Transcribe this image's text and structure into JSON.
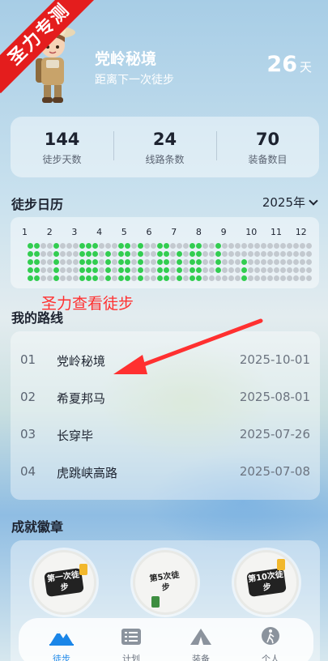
{
  "ribbon": "圣力专测",
  "header": {
    "title": "党岭秘境",
    "subtitle": "距离下一次徒步",
    "days": "26",
    "days_unit": "天"
  },
  "stats": [
    {
      "value": "144",
      "label": "徒步天数"
    },
    {
      "value": "24",
      "label": "线路条数"
    },
    {
      "value": "70",
      "label": "装备数目"
    }
  ],
  "calendar": {
    "title": "徒步日历",
    "year": "2025年",
    "months": [
      "1",
      "2",
      "3",
      "4",
      "5",
      "6",
      "7",
      "8",
      "9",
      "10",
      "11",
      "12"
    ]
  },
  "annotation": "圣力查看徒步",
  "routes": {
    "title": "我的路线",
    "items": [
      {
        "num": "01",
        "name": "党岭秘境",
        "date": "2025-10-01"
      },
      {
        "num": "02",
        "name": "希夏邦马",
        "date": "2025-08-01"
      },
      {
        "num": "03",
        "name": "长穿毕",
        "date": "2025-07-26"
      },
      {
        "num": "04",
        "name": "虎跳峡高路",
        "date": "2025-07-08"
      }
    ]
  },
  "badges": {
    "title": "成就徽章",
    "items": [
      {
        "text": "第一次徒步"
      },
      {
        "text": "第5次徒步"
      },
      {
        "text": "第10次徒步"
      }
    ]
  },
  "tabs": [
    {
      "label": "徒步",
      "icon": "mountain-icon",
      "active": true
    },
    {
      "label": "计划",
      "icon": "list-icon",
      "active": false
    },
    {
      "label": "装备",
      "icon": "tent-icon",
      "active": false
    },
    {
      "label": "个人",
      "icon": "hiker-icon",
      "active": false
    }
  ],
  "colors": {
    "active_dot": "#32cd50",
    "inactive_dot": "#c3c9cf",
    "accent": "#1a86e8",
    "annotation": "#ff3030",
    "ribbon": "#e41d1d"
  }
}
